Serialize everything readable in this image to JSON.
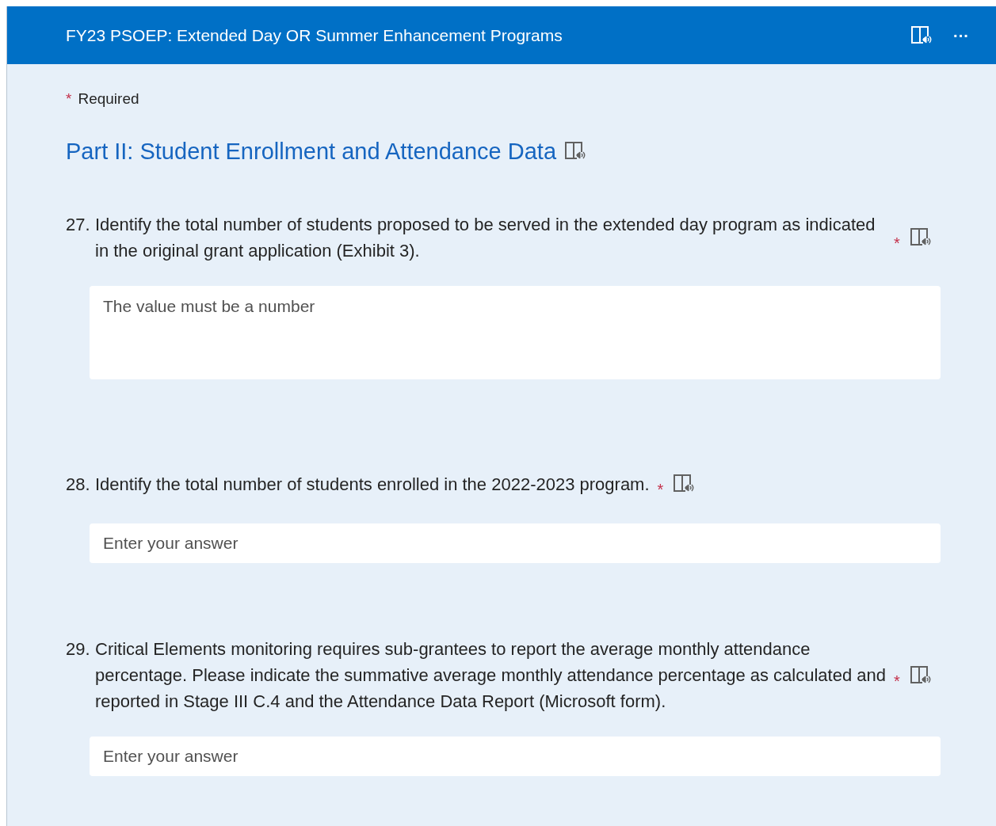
{
  "header": {
    "title": "FY23 PSOEP: Extended Day OR Summer Enhancement Programs",
    "more": "···"
  },
  "required_note": {
    "mark": "*",
    "label": "Required"
  },
  "section_title": "Part II: Student Enrollment and Attendance Data",
  "questions": [
    {
      "number": "27.",
      "text": "Identify the total number of students proposed to be served in the extended day program as indicated in the original grant application (Exhibit 3).",
      "required": true,
      "kind": "multiline",
      "placeholder": "The value must be a number"
    },
    {
      "number": "28.",
      "text": "Identify the total number of students enrolled in the 2022-2023 program.",
      "required": true,
      "kind": "single",
      "placeholder": "Enter your answer"
    },
    {
      "number": "29.",
      "text": "Critical Elements monitoring requires sub-grantees to report the average monthly attendance percentage. Please indicate the summative average monthly attendance percentage as calculated and reported in Stage III C.4 and the Attendance Data Report (Microsoft form).",
      "required": true,
      "kind": "single",
      "placeholder": "Enter your answer"
    }
  ]
}
